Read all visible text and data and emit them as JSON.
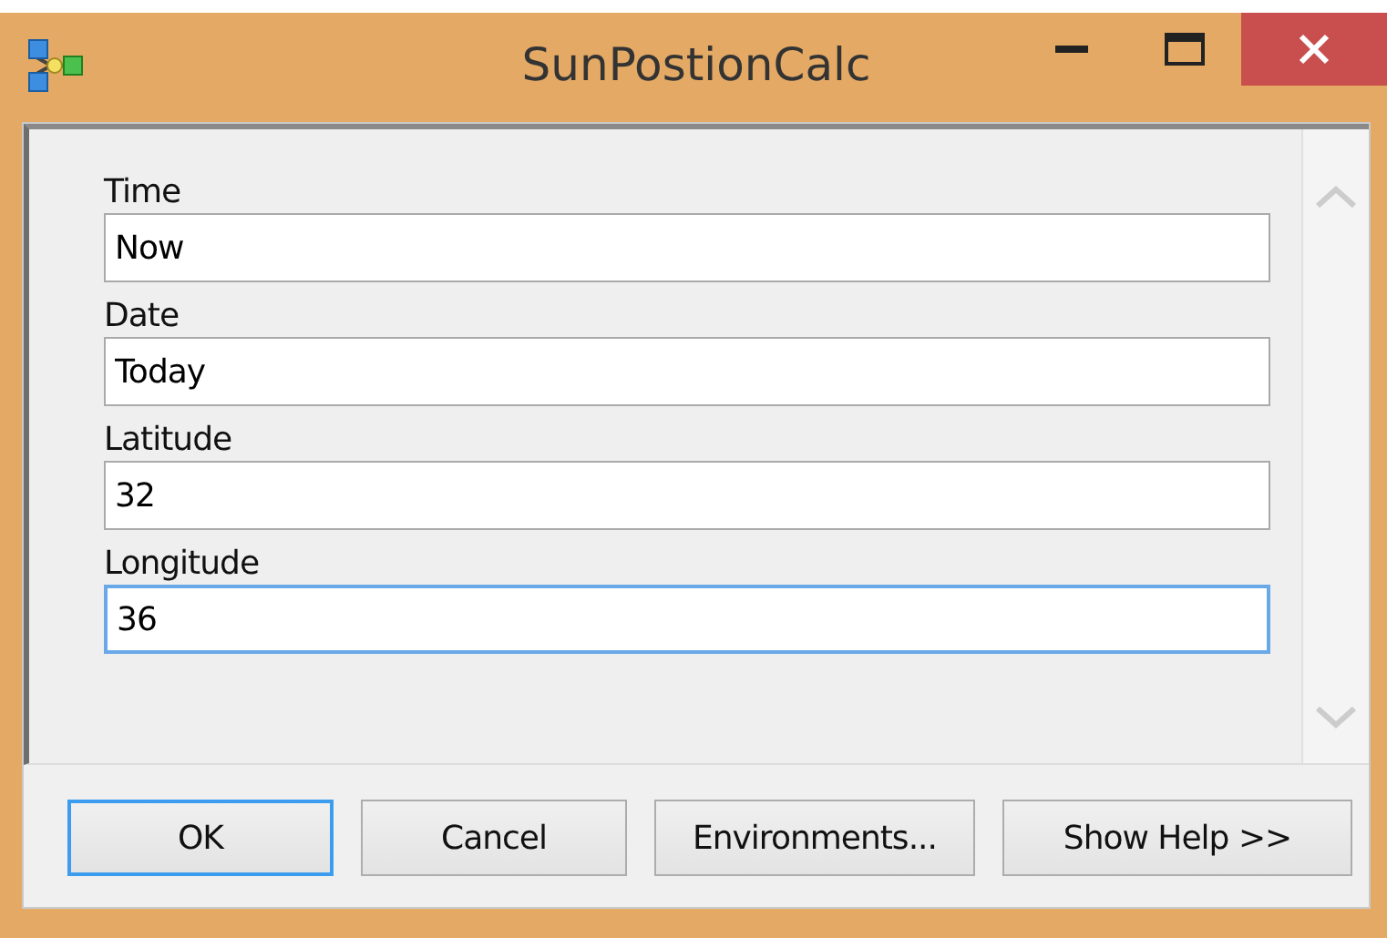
{
  "window": {
    "title": "SunPostionCalc"
  },
  "fields": [
    {
      "label": "Time",
      "value": "Now",
      "focused": false
    },
    {
      "label": "Date",
      "value": "Today",
      "focused": false
    },
    {
      "label": "Latitude",
      "value": "32",
      "focused": false
    },
    {
      "label": "Longitude",
      "value": "36",
      "focused": true
    }
  ],
  "buttons": [
    {
      "label": "OK",
      "default": true
    },
    {
      "label": "Cancel",
      "default": false
    },
    {
      "label": "Environments...",
      "default": false
    },
    {
      "label": "Show Help >>",
      "default": false
    }
  ]
}
